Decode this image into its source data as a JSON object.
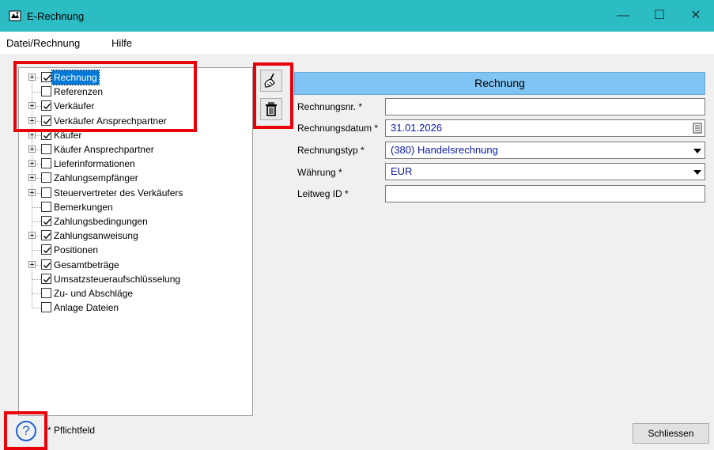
{
  "window": {
    "title": "E-Rechnung",
    "minimize": "—",
    "maximize": "☐",
    "close": "✕"
  },
  "menu": {
    "items": [
      "Datei/Rechnung",
      "Hilfe"
    ]
  },
  "tree": {
    "items": [
      {
        "label": "Rechnung",
        "checked": true,
        "expandable": true,
        "selected": true
      },
      {
        "label": "Referenzen",
        "checked": false,
        "expandable": false
      },
      {
        "label": "Verkäufer",
        "checked": true,
        "expandable": true
      },
      {
        "label": "Verkäufer Ansprechpartner",
        "checked": true,
        "expandable": true
      },
      {
        "label": "Käufer",
        "checked": true,
        "expandable": true
      },
      {
        "label": "Käufer Ansprechpartner",
        "checked": false,
        "expandable": true
      },
      {
        "label": "Lieferinformationen",
        "checked": false,
        "expandable": true
      },
      {
        "label": "Zahlungsempfänger",
        "checked": false,
        "expandable": true
      },
      {
        "label": "Steuervertreter des Verkäufers",
        "checked": false,
        "expandable": true
      },
      {
        "label": "Bemerkungen",
        "checked": false,
        "expandable": false
      },
      {
        "label": "Zahlungsbedingungen",
        "checked": true,
        "expandable": false
      },
      {
        "label": "Zahlungsanweisung",
        "checked": true,
        "expandable": true
      },
      {
        "label": "Positionen",
        "checked": true,
        "expandable": false
      },
      {
        "label": "Gesamtbeträge",
        "checked": true,
        "expandable": true
      },
      {
        "label": "Umsatzsteueraufschlüsselung",
        "checked": true,
        "expandable": false
      },
      {
        "label": "Zu- und Abschläge",
        "checked": false,
        "expandable": false
      },
      {
        "label": "Anlage Dateien",
        "checked": false,
        "expandable": false
      }
    ]
  },
  "toolbar": {
    "clear_icon": "broom-icon",
    "delete_icon": "trash-icon"
  },
  "form": {
    "header": "Rechnung",
    "fields": [
      {
        "label": "Rechnungsnr. *",
        "value": "",
        "type": "text"
      },
      {
        "label": "Rechnungsdatum *",
        "value": "31.01.2026",
        "type": "date"
      },
      {
        "label": "Rechnungstyp *",
        "value": "(380) Handelsrechnung",
        "type": "select"
      },
      {
        "label": "Währung *",
        "value": "EUR",
        "type": "select"
      },
      {
        "label": "Leitweg ID *",
        "value": "",
        "type": "text"
      }
    ]
  },
  "footer": {
    "help_glyph": "?",
    "required_note": "* Pflichtfeld",
    "close_label": "Schliessen"
  },
  "colors": {
    "titlebar": "#2bbcc4",
    "highlight": "#e8000a",
    "form_header": "#7fc4f2",
    "selection": "#0078d7",
    "field_text": "#0a1aa6"
  }
}
